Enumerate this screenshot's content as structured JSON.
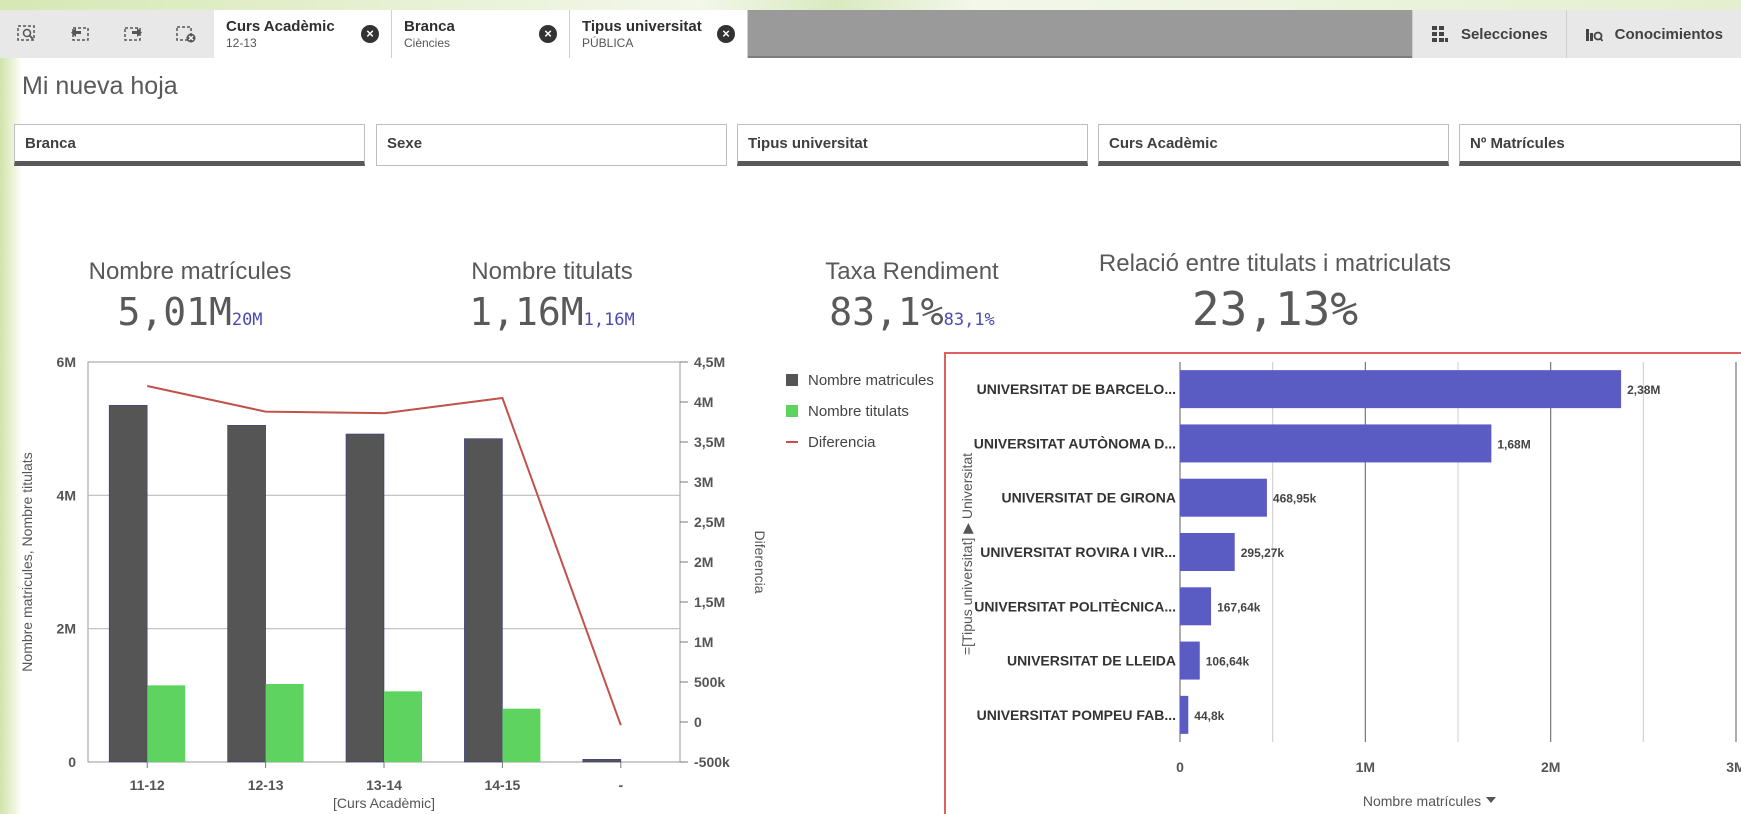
{
  "toolbar": {
    "tools": [
      "smart-search-icon",
      "step-back-icon",
      "step-forward-icon",
      "clear-selections-icon"
    ],
    "chips": [
      {
        "title": "Curs Acadèmic",
        "value": "12-13"
      },
      {
        "title": "Branca",
        "value": "Ciències"
      },
      {
        "title": "Tipus universitat",
        "value": "PÚBLICA"
      }
    ],
    "selecciones_label": "Selecciones",
    "conocimientos_label": "Conocimientos"
  },
  "sheet": {
    "title": "Mi nueva hoja"
  },
  "filters": [
    "Branca",
    "Sexe",
    "Tipus universitat",
    "Curs Acadèmic",
    "Nº Matrícules"
  ],
  "kpis": [
    {
      "title": "Nombre matrícules",
      "value": "5,01M",
      "sub": "20M"
    },
    {
      "title": "Nombre titulats",
      "value": "1,16M",
      "sub": "1,16M"
    },
    {
      "title": "Taxa Rendiment",
      "value": "83,1%",
      "sub": "83,1%"
    },
    {
      "title": "Relació entre titulats i matriculats",
      "value": "23,13%",
      "sub": ""
    }
  ],
  "colors": {
    "dark_bar": "#555555",
    "green_bar": "#5fd35f",
    "line": "#c0524a",
    "purple_bar": "#5b5bc4",
    "accent_border": "#e06060"
  },
  "chart_data": [
    {
      "type": "bar",
      "categories": [
        "11-12",
        "12-13",
        "13-14",
        "14-15",
        "-"
      ],
      "series": [
        {
          "name": "Nombre matricules",
          "values": [
            5.35,
            5.05,
            4.92,
            4.85,
            0.04
          ],
          "axis": "left"
        },
        {
          "name": "Nombre titulats",
          "values": [
            1.15,
            1.17,
            1.06,
            0.8,
            0
          ],
          "axis": "left"
        },
        {
          "name": "Diferencia",
          "type": "line",
          "values": [
            4.2,
            3.88,
            3.86,
            4.05,
            -0.04
          ],
          "axis": "right"
        }
      ],
      "xlabel": "[Curs Acadèmic]",
      "ylabel": "Nombre matricules, Nombre titulats",
      "y2label": "Diferencia",
      "ylim": [
        0,
        6
      ],
      "y2lim": [
        -0.5,
        4.5
      ],
      "yticks": [
        "0",
        "2M",
        "4M",
        "6M"
      ],
      "y2ticks": [
        "-500k",
        "0",
        "500k",
        "1M",
        "1,5M",
        "2M",
        "2,5M",
        "3M",
        "3,5M",
        "4M",
        "4,5M"
      ],
      "legend": "top-right"
    },
    {
      "type": "bar",
      "orientation": "horizontal",
      "categories": [
        "UNIVERSITAT DE BARCELO...",
        "UNIVERSITAT AUTÒNOMA D...",
        "UNIVERSITAT DE GIRONA",
        "UNIVERSITAT ROVIRA I VIR...",
        "UNIVERSITAT POLITÈCNICA...",
        "UNIVERSITAT DE LLEIDA",
        "UNIVERSITAT POMPEU FAB..."
      ],
      "values": [
        2.38,
        1.68,
        0.46895,
        0.29527,
        0.16764,
        0.10664,
        0.0448
      ],
      "value_labels": [
        "2,38M",
        "1,68M",
        "468,95k",
        "295,27k",
        "167,64k",
        "106,64k",
        "44,8k"
      ],
      "xlabel": "Nombre matrícules",
      "ylabel": "=[Tipus universitat] ▶ Universitat",
      "xlim": [
        0,
        3
      ],
      "xticks": [
        "0",
        "1M",
        "2M",
        "3M"
      ]
    }
  ]
}
